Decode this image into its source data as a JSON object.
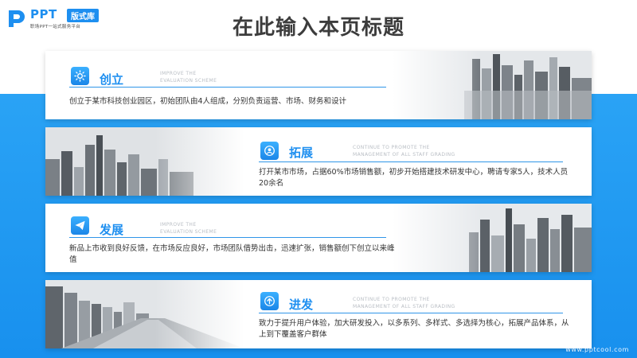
{
  "logo": {
    "ppt": "PPT",
    "badge": "版式库",
    "sub": "职场PPT一站式服务平台"
  },
  "title": "在此输入本页标题",
  "cards": [
    {
      "icon": "sun-icon",
      "heading": "创立",
      "en_line1": "IMPROVE THE",
      "en_line2": "EVALUATION SCHEME",
      "description": "创立于某市科技创业园区，初始团队由4人组成，分别负责运营、市场、财务和设计"
    },
    {
      "icon": "user-badge-icon",
      "heading": "拓展",
      "en_line1": "CONTINUE TO PROMOTE THE",
      "en_line2": "MANAGEMENT OF ALL STAFF GRADING",
      "description": "打开某市市场，占据60%市场销售额，初步开始搭建技术研发中心，聘请专家5人，技术人员20余名"
    },
    {
      "icon": "paper-plane-icon",
      "heading": "发展",
      "en_line1": "IMPROVE THE",
      "en_line2": "EVALUATION SCHEME",
      "description": "新品上市收到良好反馈，在市场反应良好，市场团队借势出击，迅速扩张，销售额创下创立以来峰值"
    },
    {
      "icon": "up-arrow-circle-icon",
      "heading": "进发",
      "en_line1": "CONTINUE TO PROMOTE THE",
      "en_line2": "MANAGEMENT OF ALL STAFF GRADING",
      "description": "致力于提升用户体验，加大研发投入，以多系列、多样式、多选择为核心，拓展产品体系，从上到下覆盖客户群体"
    }
  ],
  "footer": {
    "url": "www.pptcool.com"
  },
  "colors": {
    "accent": "#1e8ff0",
    "band": "#1890ee"
  }
}
